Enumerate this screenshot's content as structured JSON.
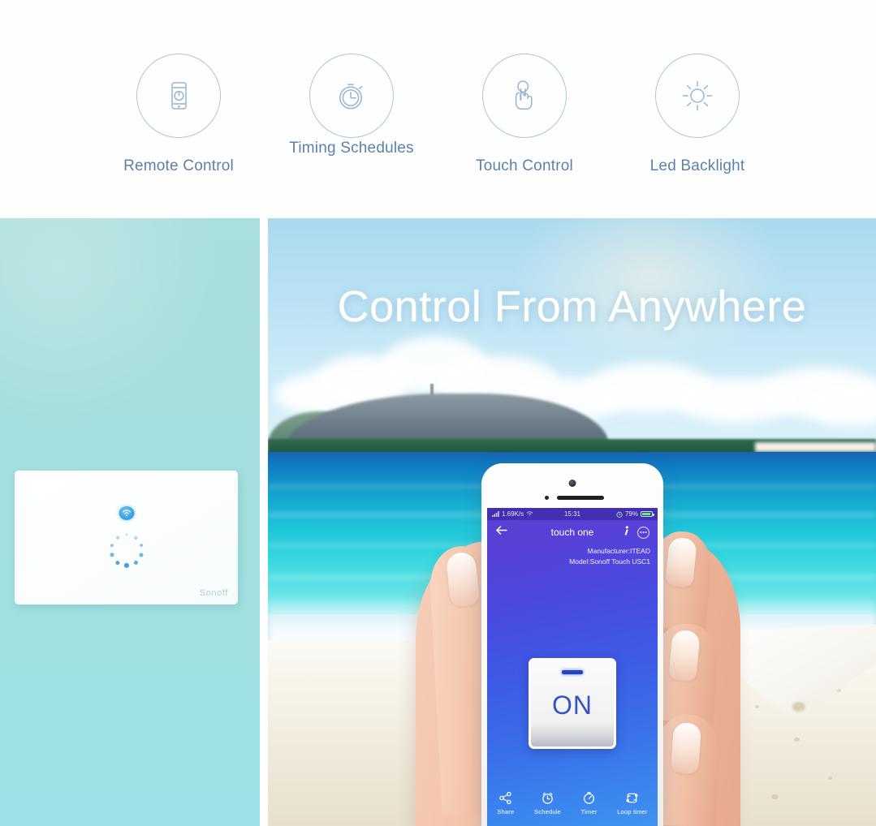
{
  "features": {
    "items": [
      {
        "icon": "phone-power-icon",
        "label": "Remote Control"
      },
      {
        "icon": "stopwatch-icon",
        "label": "Timing Schedules"
      },
      {
        "icon": "touch-hand-icon",
        "label": "Touch Control"
      },
      {
        "icon": "sun-icon",
        "label": "Led Backlight"
      }
    ],
    "label_color": "#5b81ad",
    "ring_color": "#aac6de"
  },
  "left_panel": {
    "background_color": "#a6dedd",
    "switch": {
      "brand": "Sonoff",
      "wifi_indicator_icon": "wifi-icon",
      "led_ring_icon": "led-ring-icon",
      "body_color": "#ffffff"
    }
  },
  "right_panel": {
    "headline": "Control From Anywhere",
    "headline_color": "#ffffff",
    "scene": {
      "sky_color": "#b4dff2",
      "sea_color": "#1dc3d8",
      "sand_color": "#f6f2e8"
    },
    "phone": {
      "status_bar": {
        "carrier": "1.69K/s",
        "time": "15:31",
        "battery_percent": "79%"
      },
      "app_bar": {
        "back_icon": "arrow-left-icon",
        "title": "touch one",
        "info_icon": "info-icon",
        "more_icon": "more-icon"
      },
      "device_meta": {
        "manufacturer": "Manufacturer:ITEAD",
        "model": "Model:Sonoff Touch USC1"
      },
      "power_button": {
        "state_label": "ON",
        "accent_color": "#3453c9"
      },
      "bottom_nav": [
        {
          "icon": "share-icon",
          "label": "Share"
        },
        {
          "icon": "alarm-clock-icon",
          "label": "Schedule"
        },
        {
          "icon": "stopwatch-icon",
          "label": "Timer"
        },
        {
          "icon": "loop-icon",
          "label": "Loop timer"
        }
      ]
    }
  }
}
